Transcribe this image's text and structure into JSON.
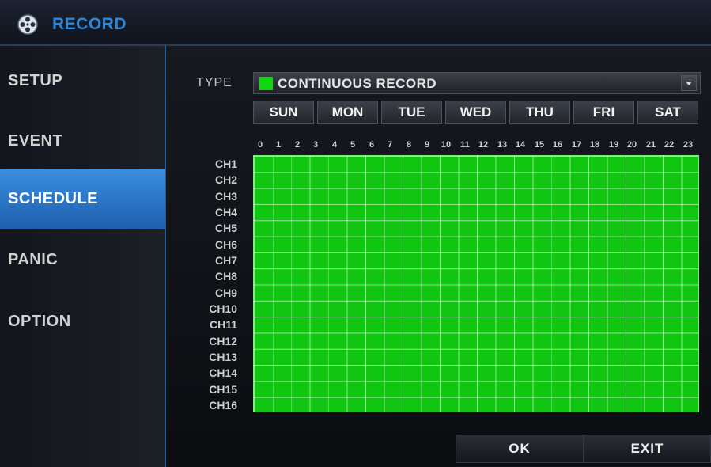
{
  "window": {
    "title": "RECORD",
    "logo_icon": "film-reel-icon"
  },
  "sidebar": {
    "items": [
      {
        "label": "SETUP",
        "active": false
      },
      {
        "label": "EVENT",
        "active": false
      },
      {
        "label": "SCHEDULE",
        "active": true
      },
      {
        "label": "PANIC",
        "active": false
      },
      {
        "label": "OPTION",
        "active": false
      }
    ]
  },
  "schedule": {
    "type_label": "TYPE",
    "type_value": "CONTINUOUS RECORD",
    "type_color": "#11d611",
    "days": [
      "SUN",
      "MON",
      "TUE",
      "WED",
      "THU",
      "FRI",
      "SAT"
    ],
    "hours": [
      "0",
      "1",
      "2",
      "3",
      "4",
      "5",
      "6",
      "7",
      "8",
      "9",
      "10",
      "11",
      "12",
      "13",
      "14",
      "15",
      "16",
      "17",
      "18",
      "19",
      "20",
      "21",
      "22",
      "23"
    ],
    "channels": [
      "CH1",
      "CH2",
      "CH3",
      "CH4",
      "CH5",
      "CH6",
      "CH7",
      "CH8",
      "CH9",
      "CH10",
      "CH11",
      "CH12",
      "CH13",
      "CH14",
      "CH15",
      "CH16"
    ],
    "grid_fill": "continuous (all cells)"
  },
  "footer": {
    "ok_label": "OK",
    "exit_label": "EXIT"
  },
  "colors": {
    "accent": "#2f86d6",
    "active_tab": "#2a78c8",
    "record_green": "#11c611"
  }
}
